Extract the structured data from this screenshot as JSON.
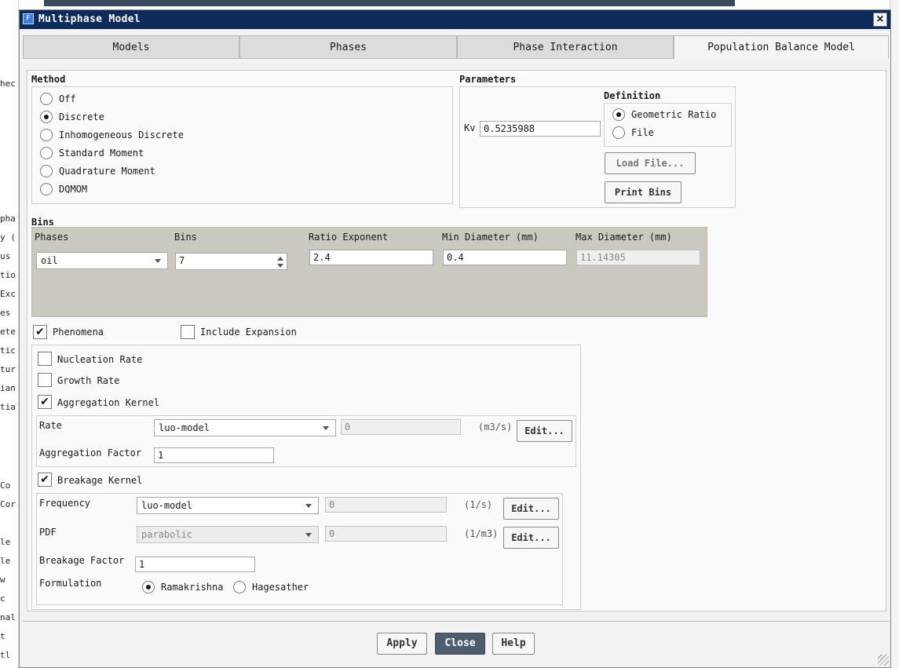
{
  "background": {
    "left_fragments": [
      "hec",
      "pha",
      "y (",
      "us",
      "tio",
      "Exc",
      "es",
      "ete",
      "tic",
      "tur",
      "ian",
      "tia",
      "Co",
      "Cor",
      "le",
      "le",
      "w",
      "c",
      "nal",
      "t",
      "tl"
    ]
  },
  "window": {
    "title": "Multiphase Model",
    "app_icon": "F",
    "close_label": "×"
  },
  "tabs": [
    {
      "label": "Models",
      "active": false
    },
    {
      "label": "Phases",
      "active": false
    },
    {
      "label": "Phase Interaction",
      "active": false
    },
    {
      "label": "Population Balance Model",
      "active": true
    }
  ],
  "method": {
    "heading": "Method",
    "options": [
      {
        "label": "Off",
        "selected": false
      },
      {
        "label": "Discrete",
        "selected": true
      },
      {
        "label": "Inhomogeneous Discrete",
        "selected": false
      },
      {
        "label": "Standard Moment",
        "selected": false
      },
      {
        "label": "Quadrature Moment",
        "selected": false
      },
      {
        "label": "DQMOM",
        "selected": false
      }
    ]
  },
  "parameters": {
    "heading": "Parameters",
    "kv_label": "Kv",
    "kv_value": "0.5235988",
    "definition": {
      "heading": "Definition",
      "options": [
        {
          "label": "Geometric Ratio",
          "selected": true
        },
        {
          "label": "File",
          "selected": false
        }
      ]
    },
    "load_file_label": "Load File...",
    "print_bins_label": "Print Bins"
  },
  "bins": {
    "heading": "Bins",
    "headers": {
      "phases": "Phases",
      "bins": "Bins",
      "ratio_exponent": "Ratio Exponent",
      "min_diameter": "Min Diameter (mm)",
      "max_diameter": "Max Diameter (mm)"
    },
    "phase_value": "oil",
    "bins_value": "7",
    "ratio_exponent_value": "2.4",
    "min_diameter_value": "0.4",
    "max_diameter_value": "11.14305"
  },
  "phenomena": {
    "label": "Phenomena",
    "checked": true,
    "include_expansion_label": "Include Expansion",
    "include_expansion_checked": false,
    "nucleation_label": "Nucleation Rate",
    "nucleation_checked": false,
    "growth_label": "Growth Rate",
    "growth_checked": false,
    "aggregation": {
      "label": "Aggregation Kernel",
      "checked": true,
      "rate_label": "Rate",
      "rate_model": "luo-model",
      "rate_value": "0",
      "rate_unit": "(m3/s)",
      "edit_label": "Edit...",
      "factor_label": "Aggregation Factor",
      "factor_value": "1"
    },
    "breakage": {
      "label": "Breakage Kernel",
      "checked": true,
      "frequency_label": "Frequency",
      "frequency_model": "luo-model",
      "frequency_value": "0",
      "frequency_unit": "(1/s)",
      "pdf_label": "PDF",
      "pdf_model": "parabolic",
      "pdf_value": "0",
      "pdf_unit": "(1/m3)",
      "edit_label": "Edit...",
      "factor_label": "Breakage Factor",
      "factor_value": "1",
      "formulation_label": "Formulation",
      "formulation_options": [
        {
          "label": "Ramakrishna",
          "selected": true
        },
        {
          "label": "Hagesather",
          "selected": false
        }
      ]
    }
  },
  "footer": {
    "apply_label": "Apply",
    "close_label": "Close",
    "help_label": "Help"
  }
}
